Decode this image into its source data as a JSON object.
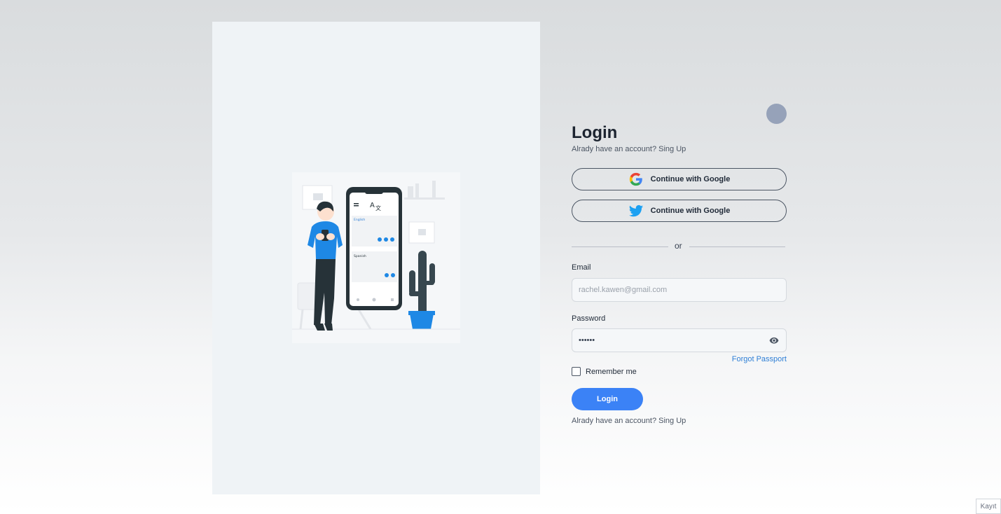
{
  "left_panel": {
    "illustration_alt": ""
  },
  "illustration": {
    "lang1": "English",
    "lang2": "Spanish"
  },
  "form": {
    "title": "Login",
    "subtitle": "Alrady have an account? Sing Up",
    "google_button": "Continue with Google",
    "twitter_button": "Continue with Google",
    "divider_text": "or",
    "email_label": "Email",
    "email_placeholder": "rachel.kawen@gmail.com",
    "password_label": "Password",
    "password_value": "••••••",
    "forgot_link": "Forgot Passport",
    "remember_label": "Remember me",
    "login_button": "Login",
    "footer_text": "Alrady have an account? Sing Up"
  },
  "corner_badge": "Kayıt",
  "colors": {
    "accent": "#3b82f6",
    "link": "#2f7fd6",
    "avatar": "#96a2b9",
    "twitter": "#1da1f2"
  },
  "icons": {
    "google": "google-icon",
    "twitter": "twitter-icon",
    "eye": "eye-icon"
  }
}
